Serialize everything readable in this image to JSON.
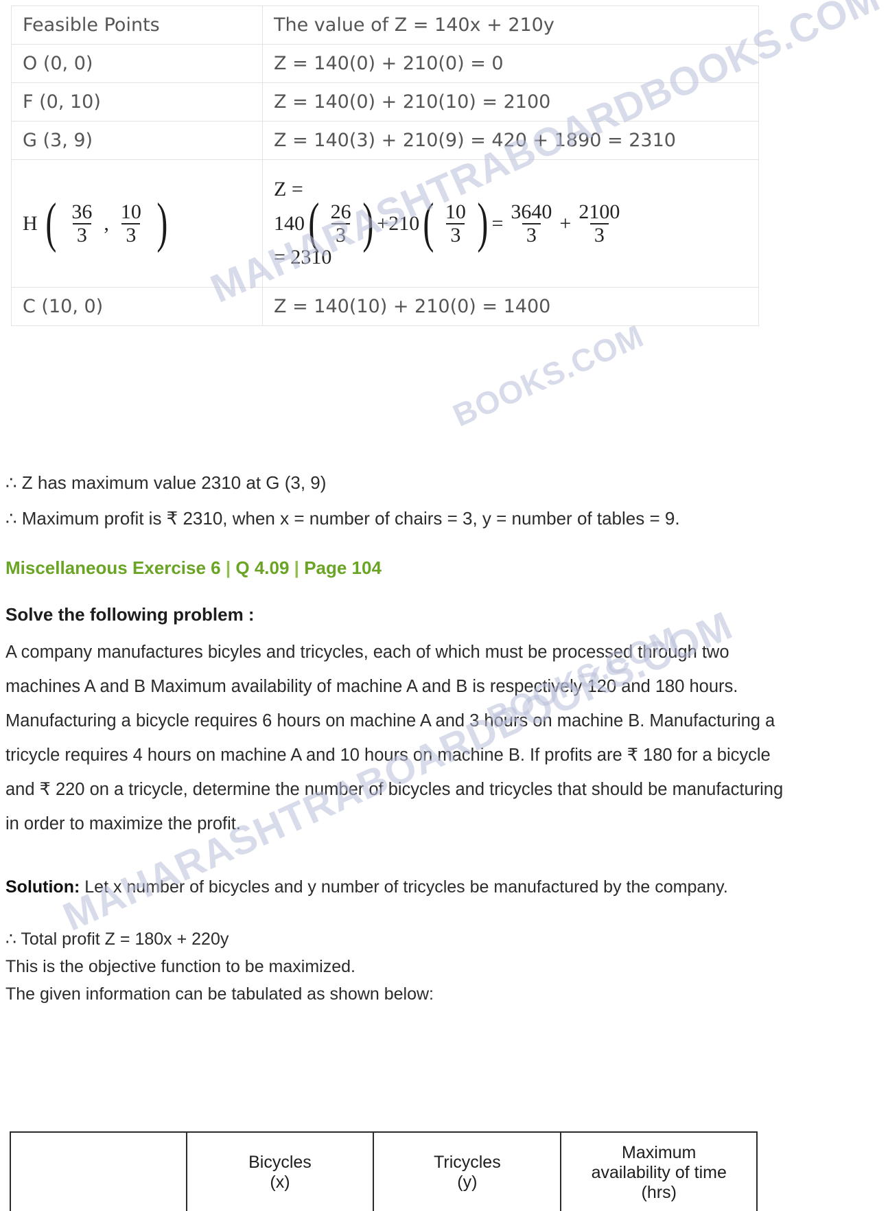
{
  "feasible_table": {
    "headers": [
      "Feasible Points",
      "The value of Z = 140x + 210y"
    ],
    "rows": [
      {
        "point": "O (0, 0)",
        "value": "Z = 140(0) + 210(0) = 0"
      },
      {
        "point": "F (0, 10)",
        "value": "Z = 140(0) + 210(10) = 2100"
      },
      {
        "point": "G (3, 9)",
        "value": "Z = 140(3) + 210(9) = 420 + 1890 = 2310"
      },
      {
        "point_label": "H",
        "point_frac1_num": "36",
        "point_frac1_den": "3",
        "point_comma": ",",
        "point_frac2_num": "10",
        "point_frac2_den": "3",
        "value_line1": "Z =",
        "value_c1": "140",
        "value_f1_num": "26",
        "value_f1_den": "3",
        "value_plus": "+",
        "value_c2": "210",
        "value_f2_num": "10",
        "value_f2_den": "3",
        "value_eq": "=",
        "value_f3_num": "3640",
        "value_f3_den": "3",
        "value_plus2": "+",
        "value_f4_num": "2100",
        "value_f4_den": "3",
        "value_line3": "= 2310"
      },
      {
        "point": "C (10, 0)",
        "value": "Z = 140(10) + 210(0) = 1400"
      }
    ]
  },
  "conclusions": {
    "line1": "∴ Z has maximum value 2310 at G (3, 9)",
    "line2": "∴ Maximum profit is ₹ 2310, when x = number of chairs = 3, y = number of tables = 9."
  },
  "exercise_heading": {
    "part1": "Miscellaneous Exercise 6",
    "sep1": "|",
    "part2": "Q 4.09",
    "sep2": "|",
    "part3": "Page 104"
  },
  "solve_heading": "Solve the following problem :",
  "question_text": "A company manufactures bicyles and tricycles, each of which must be processed through two machines A and B Maximum availability of machine A and B is respectively 120 and 180 hours. Manufacturing a bicycle requires 6 hours on machine A and 3 hours on machine B. Manufacturing a tricycle requires 4 hours on machine A and 10 hours on machine B. If profits are ₹ 180 for a bicycle and ₹ 220 on a tricycle, determine the number of bicycles and tricycles that should be manufacturing in order to maximize the profit.",
  "solution": {
    "label": "Solution:",
    "line1": " Let x number of bicycles and y number of tricycles be manufactured by the company.",
    "line2": "∴ Total profit Z = 180x + 220y",
    "line3": "This is the objective function to be maximized.",
    "line4": "The given information can be tabulated as shown below:"
  },
  "info_table": {
    "headers": [
      {
        "main": "",
        "sub": ""
      },
      {
        "main": "Bicycles",
        "sub": "(x)"
      },
      {
        "main": "Tricycles",
        "sub": "(y)"
      },
      {
        "main": "Maximum",
        "sub": "availability of time",
        "sub2": "(hrs)"
      }
    ]
  },
  "watermarks": {
    "text1": "MAHARASHTRABOARDBOOKS.COM",
    "text2": "MAHARASHTRABOARDBOOKS.COM",
    "text3": "BOOKS.COM",
    "text4": "BOOKS.COM"
  },
  "colors": {
    "green": "#6aa424",
    "text": "#2b2b2b",
    "table_border": "#e3e3e3",
    "watermark": "#b9bed8"
  }
}
